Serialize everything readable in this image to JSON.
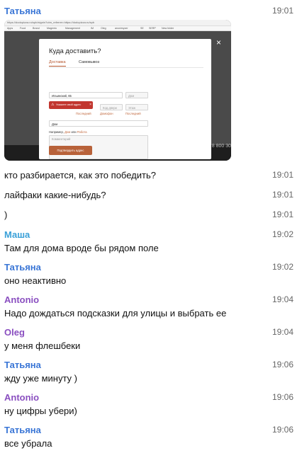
{
  "chat": {
    "messages": [
      {
        "sender": "Татьяна",
        "color": "#3a76d6",
        "time": "19:01",
        "text": ""
      },
      {
        "sender": "",
        "time": "19:01",
        "text": "кто разбирается, как это победить?"
      },
      {
        "sender": "",
        "time": "19:01",
        "text": "лайфаки какие-нибудь?"
      },
      {
        "sender": "",
        "time": "19:01",
        "text": ")"
      },
      {
        "sender": "Маша",
        "color": "#3aa0d8",
        "time": "19:02",
        "text": "Там для дома вроде бы рядом поле"
      },
      {
        "sender": "Татьяна",
        "color": "#3a76d6",
        "time": "19:02",
        "text": "оно неактивно"
      },
      {
        "sender": "Antonio",
        "color": "#8a4fc0",
        "time": "19:04",
        "text": "Надо дождаться подсказки для улицы и выбрать ее"
      },
      {
        "sender": "Oleg",
        "color": "#8a4fc0",
        "time": "19:04",
        "text": "у меня флешбеки"
      },
      {
        "sender": "Татьяна",
        "color": "#3a76d6",
        "time": "19:06",
        "text": "жду уже минуту )"
      },
      {
        "sender": "Antonio",
        "color": "#8a4fc0",
        "time": "19:06",
        "text": "ну цифры убери)"
      },
      {
        "sender": "Татьяна",
        "color": "#3a76d6",
        "time": "19:06",
        "text": "все убрала"
      }
    ]
  },
  "screenshot": {
    "url": "https://dodopizza.ru/spb/signin?utm_referrer=https://dodopizza.ru/spb",
    "bookmarks": [
      "Apps",
      "Food",
      "Brand",
      "Magento",
      "Management",
      "IM",
      "Oleg",
      "anonimyzer",
      "SE",
      "SERP",
      "New folder"
    ],
    "close_glyph": "×",
    "phone": "8 800 30",
    "modal": {
      "title": "Куда доставить?",
      "tabs": [
        "Доставка",
        "Самовывоз"
      ],
      "street_value": "Ильинский, 65",
      "house_placeholder": "Дом",
      "error_text": "Укажите свой адрес",
      "error_warn": "⚠",
      "error_close": "×",
      "door_placeholder": "Код двери",
      "floor_placeholder": "Этаж",
      "recent_1": "Последний",
      "recent_2": "Домофон",
      "recent_3": "Последний",
      "label_value": "Дом",
      "hint_prefix": "Например,",
      "hint_link_1": "Дом",
      "hint_mid": "или",
      "hint_link_2": "Работа",
      "comment_placeholder": "Комментарий",
      "confirm_label": "Подтвердить адрес"
    }
  }
}
